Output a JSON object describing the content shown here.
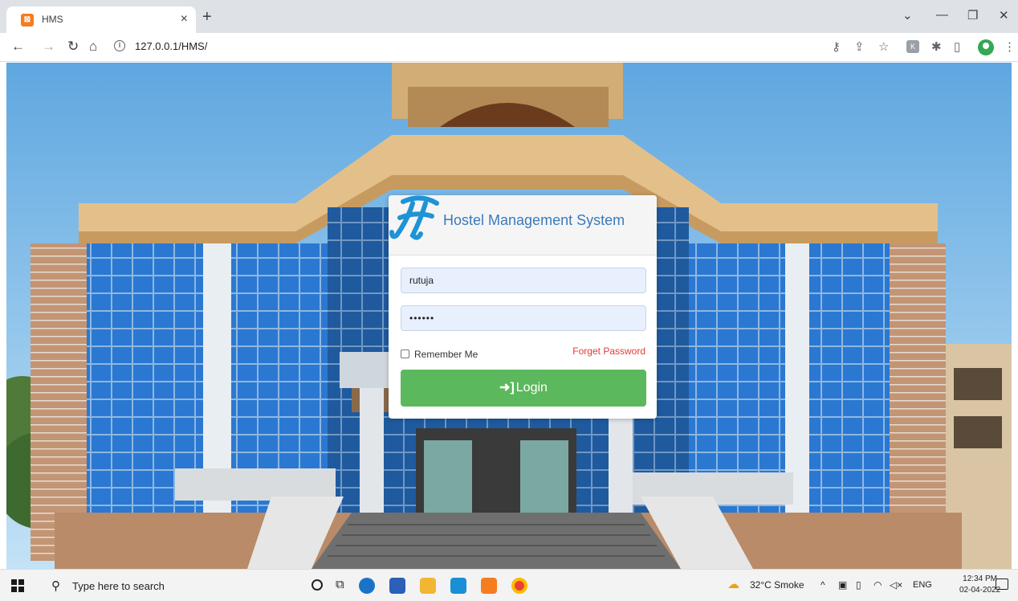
{
  "browser": {
    "tab_title": "HMS",
    "url": "127.0.0.1/HMS/"
  },
  "login": {
    "app_title": "Hostel Management System",
    "username": "rutuja",
    "password_masked": "••••••",
    "remember_label": "Remember Me",
    "forget_label": "Forget Password",
    "login_label": "Login",
    "colors": {
      "login_button": "#5cb85c",
      "forget_link": "#e53935",
      "title": "#3b7ab8"
    }
  },
  "taskbar": {
    "search_placeholder": "Type here to search",
    "weather": "32°C  Smoke",
    "language": "ENG",
    "time": "12:34 PM",
    "date": "02-04-2022"
  }
}
